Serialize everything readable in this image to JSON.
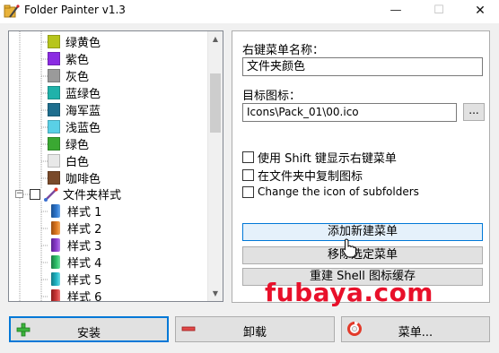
{
  "window": {
    "title": "Folder Painter v1.3",
    "minimize": "—",
    "maximize": "☐",
    "close": "✕"
  },
  "tree": {
    "colors": [
      {
        "label": "绿黄色",
        "color": "#b7c51c"
      },
      {
        "label": "紫色",
        "color": "#8a2be2"
      },
      {
        "label": "灰色",
        "color": "#9a9a9a"
      },
      {
        "label": "蓝绿色",
        "color": "#20b2aa"
      },
      {
        "label": "海军蓝",
        "color": "#1f6e8e"
      },
      {
        "label": "浅蓝色",
        "color": "#5ad0e6"
      },
      {
        "label": "绿色",
        "color": "#3aa832"
      },
      {
        "label": "白色",
        "color": "#e8e8e8"
      },
      {
        "label": "咖啡色",
        "color": "#7a4a2a"
      }
    ],
    "group": {
      "label": "文件夹样式",
      "expander": "−"
    },
    "styles": [
      {
        "label": "样式 1",
        "color": "#2f78d0"
      },
      {
        "label": "样式 2",
        "color": "#e07a22"
      },
      {
        "label": "样式 3",
        "color": "#8e3fd0"
      },
      {
        "label": "样式 4",
        "color": "#2ec26a"
      },
      {
        "label": "样式 5",
        "color": "#22b8c8"
      },
      {
        "label": "样式 6",
        "color": "#d03a3a"
      }
    ],
    "scroll_up": "▲",
    "scroll_down": "▼"
  },
  "panel": {
    "menu_name_label": "右键菜单名称：",
    "menu_name_value": "文件夹颜色",
    "target_icon_label": "目标图标：",
    "target_icon_value": "Icons\\Pack_01\\00.ico",
    "browse_label": "...",
    "checkboxes": [
      {
        "label": "使用 Shift 键显示右键菜单",
        "checked": false
      },
      {
        "label": "在文件夹中复制图标",
        "checked": false
      },
      {
        "label": "Change the icon of subfolders",
        "checked": false
      }
    ],
    "add_menu_button": "添加新建菜单",
    "remove_menu_button": "移除选定菜单",
    "rebuild_cache_button": "重建 Shell 图标缓存"
  },
  "bottom": {
    "install_label": "安装",
    "uninstall_label": "卸载",
    "menu_label": "菜单..."
  },
  "watermark": "fubaya.com",
  "colors": {
    "accent": "#0078d7",
    "install_icon": "#3cb53c",
    "uninstall_icon": "#e04848",
    "lifebuoy": "#e23a2a",
    "watermark": "#e8102a"
  }
}
